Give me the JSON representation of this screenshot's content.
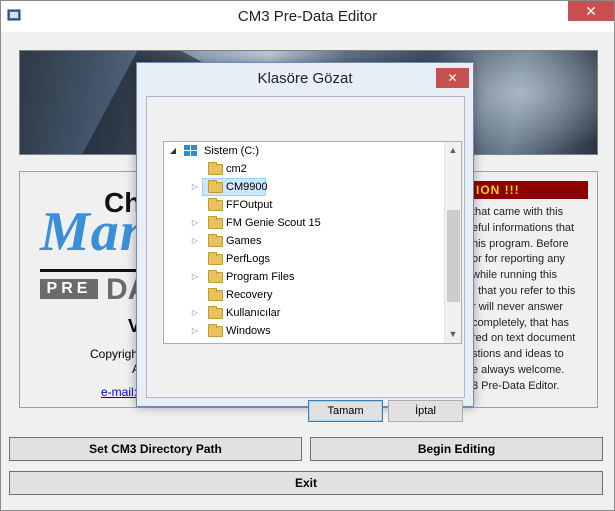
{
  "window": {
    "title": "CM3 Pre-Data Editor",
    "close_glyph": "✕"
  },
  "info_panel": {
    "logo_cha": "Cha",
    "logo_man": "Man",
    "pre_label": "PRE",
    "data_fragment": "DA",
    "version_fragment": "V",
    "copyright_fragment": "Copyright",
    "al_fragment": "Al",
    "email_fragment": "e-mail:",
    "attention_fragment": "ION  !!!",
    "notice_lines": [
      "that came with this",
      "eful informations that",
      "his program. Before",
      "or for reporting any",
      "while running this",
      "I that you refer to this",
      "r will never answer",
      "completely, that has",
      "red on text document",
      "stions and ideas to",
      "e always welcome.",
      "3 Pre-Data Editor."
    ]
  },
  "buttons": {
    "set_dir": "Set CM3 Directory Path",
    "begin": "Begin Editing",
    "exit": "Exit"
  },
  "dialog": {
    "title": "Klasöre Gözat",
    "close_glyph": "✕",
    "tree": {
      "root": "Sistem (C:)",
      "items": [
        {
          "label": "cm2",
          "expandable": false,
          "selected": false
        },
        {
          "label": "CM9900",
          "expandable": true,
          "selected": true
        },
        {
          "label": "FFOutput",
          "expandable": false,
          "selected": false
        },
        {
          "label": "FM Genie Scout 15",
          "expandable": true,
          "selected": false
        },
        {
          "label": "Games",
          "expandable": true,
          "selected": false
        },
        {
          "label": "PerfLogs",
          "expandable": false,
          "selected": false
        },
        {
          "label": "Program Files",
          "expandable": true,
          "selected": false
        },
        {
          "label": "Recovery",
          "expandable": false,
          "selected": false
        },
        {
          "label": "Kullanıcılar",
          "expandable": true,
          "selected": false
        },
        {
          "label": "Windows",
          "expandable": true,
          "selected": false
        }
      ]
    },
    "ok_label": "Tamam",
    "cancel_label": "İptal"
  },
  "colors": {
    "accent_blue": "#3b8fd9",
    "attention_bg": "#8b0000",
    "attention_text": "#ffd200",
    "selection": "#cce8ff"
  }
}
